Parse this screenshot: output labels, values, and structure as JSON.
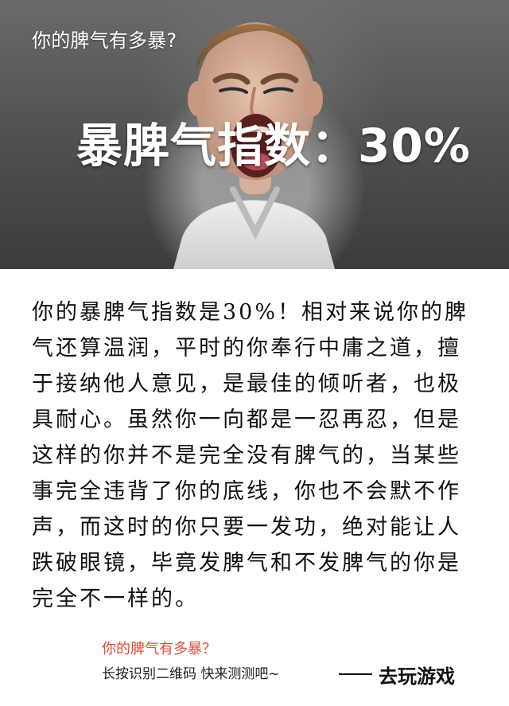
{
  "hero": {
    "question": "你的脾气有多暴?",
    "score_text": "暴脾气指数：30%",
    "score_percent": 30
  },
  "body": {
    "text": "你的暴脾气指数是30%！相对来说你的脾气还算温润，平时的你奉行中庸之道，擅于接纳他人意见，是最佳的倾听者，也极具耐心。虽然你一向都是一忍再忍，但是这样的你并不是完全没有脾气的，当某些事完全违背了你的底线，你也不会默不作声，而这时的你只要一发功，绝对能让人跌破眼镜，毕竟发脾气和不发脾气的你是完全不一样的。"
  },
  "footer": {
    "question": "你的脾气有多暴？",
    "subtext": "长按识别二维码  快来测测吧~",
    "cta_label": "去玩游戏"
  },
  "colors": {
    "accent": "#e74c3c",
    "hero_bg": "#505050"
  },
  "icons": {
    "dash": "long-dash-icon",
    "hero_image": "angry-child-illustration"
  }
}
